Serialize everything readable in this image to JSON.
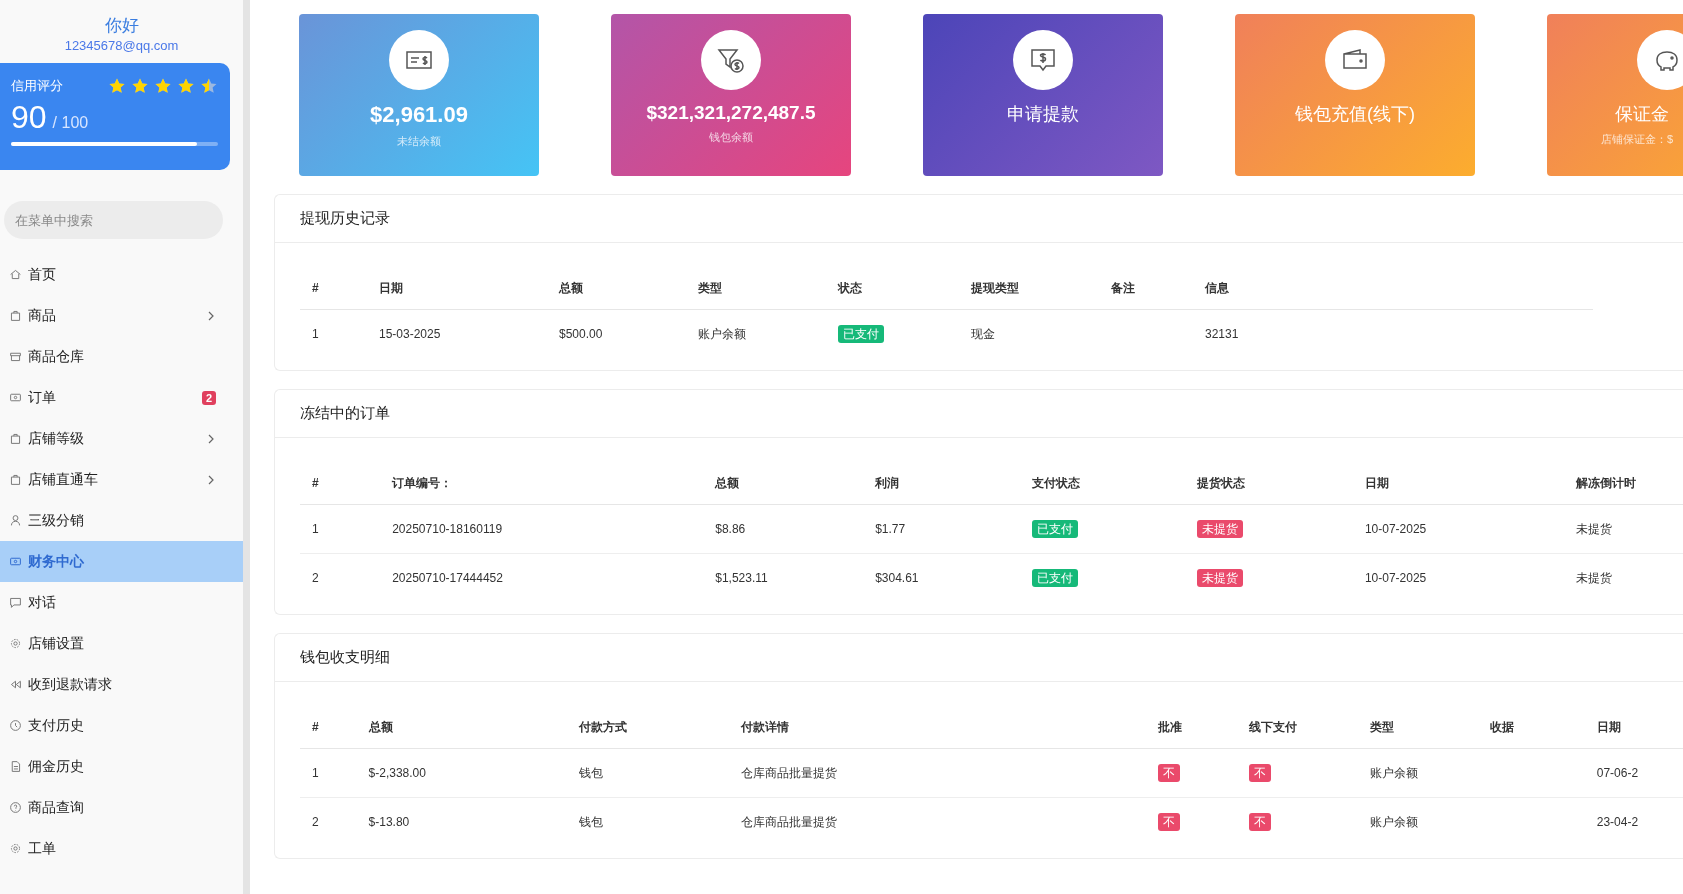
{
  "sidebar": {
    "greeting": "你好",
    "email": "12345678@qq.com",
    "credit": {
      "label": "信用评分",
      "stars": 4.5,
      "score": "90",
      "max": "/ 100",
      "level": 0.9
    },
    "search": {
      "placeholder": "在菜单中搜索"
    },
    "items": [
      {
        "label": "首页",
        "selected": false,
        "has_submenu": false
      },
      {
        "label": "商品",
        "selected": false,
        "has_submenu": true
      },
      {
        "label": "商品仓库",
        "selected": false,
        "has_submenu": false
      },
      {
        "label": "订单",
        "selected": false,
        "has_submenu": false,
        "badge": "2"
      },
      {
        "label": "店铺等级",
        "selected": false,
        "has_submenu": true
      },
      {
        "label": "店铺直通车",
        "selected": false,
        "has_submenu": true
      },
      {
        "label": "三级分销",
        "selected": false,
        "has_submenu": false
      },
      {
        "label": "财务中心",
        "selected": true,
        "has_submenu": false
      },
      {
        "label": "对话",
        "selected": false,
        "has_submenu": false
      },
      {
        "label": "店铺设置",
        "selected": false,
        "has_submenu": false
      },
      {
        "label": "收到退款请求",
        "selected": false,
        "has_submenu": false
      },
      {
        "label": "支付历史",
        "selected": false,
        "has_submenu": false
      },
      {
        "label": "佣金历史",
        "selected": false,
        "has_submenu": false
      },
      {
        "label": "商品查询",
        "selected": false,
        "has_submenu": false
      },
      {
        "label": "工单",
        "selected": false,
        "has_submenu": false
      }
    ]
  },
  "cards": [
    {
      "kind": "amount",
      "value": "$2,961.09",
      "label": "未结余额"
    },
    {
      "kind": "amount",
      "value": "$321,321,272,487.5",
      "label": "钱包余额"
    },
    {
      "kind": "action",
      "value": "申请提款"
    },
    {
      "kind": "action",
      "value": "钱包充值(线下)"
    },
    {
      "kind": "action",
      "value": "保证金",
      "label": "店铺保证金：$"
    }
  ],
  "withdrawals": {
    "title": "提现历史记录",
    "columns": [
      "#",
      "日期",
      "总额",
      "类型",
      "状态",
      "提现类型",
      "备注",
      "信息"
    ],
    "rows": [
      {
        "cells": [
          "1",
          "15-03-2025",
          "$500.00",
          "账户余额",
          {
            "text": "已支付",
            "color": "#16b979"
          },
          "现金",
          "",
          "32131"
        ]
      }
    ]
  },
  "frozen_orders": {
    "title": "冻结中的订单",
    "columns": [
      "#",
      "订单编号：",
      "总额",
      "利润",
      "支付状态",
      "提货状态",
      "日期",
      "解冻倒计时"
    ],
    "rows": [
      {
        "cells": [
          "1",
          "20250710-18160119",
          "$8.86",
          "$1.77",
          {
            "text": "已支付",
            "color": "#16b979"
          },
          {
            "text": "未提货",
            "color": "#ea4a6b"
          },
          "10-07-2025",
          "未提货"
        ]
      },
      {
        "cells": [
          "2",
          "20250710-17444452",
          "$1,523.11",
          "$304.61",
          {
            "text": "已支付",
            "color": "#16b979"
          },
          {
            "text": "未提货",
            "color": "#ea4a6b"
          },
          "10-07-2025",
          "未提货"
        ]
      }
    ]
  },
  "wallet": {
    "title": "钱包收支明细",
    "columns": [
      "#",
      "总额",
      "付款方式",
      "付款详情",
      "批准",
      "线下支付",
      "类型",
      "收据",
      "日期"
    ],
    "rows": [
      {
        "cells": [
          "1",
          "$-2,338.00",
          "钱包",
          "仓库商品批量提货",
          {
            "text": "不",
            "color": "#ea4a6b"
          },
          {
            "text": "不",
            "color": "#ea4a6b"
          },
          "账户余额",
          "",
          "07-06-2"
        ]
      },
      {
        "cells": [
          "2",
          "$-13.80",
          "钱包",
          "仓库商品批量提货",
          {
            "text": "不",
            "color": "#ea4a6b"
          },
          {
            "text": "不",
            "color": "#ea4a6b"
          },
          "账户余额",
          "",
          "23-04-2"
        ]
      }
    ]
  }
}
